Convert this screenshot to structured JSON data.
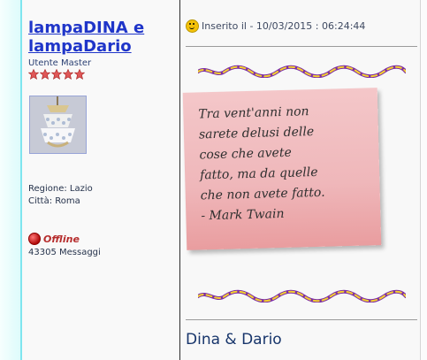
{
  "user": {
    "name": "lampaDINA e lampaDario",
    "rank": "Utente Master",
    "star_count": 5,
    "region": "Regione: Lazio",
    "city": "Città: Roma",
    "status": "Offline",
    "messages": "43305 Messaggi"
  },
  "post": {
    "date_text": "Inserito il - 10/03/2015 : 06:24:44",
    "quote_text": "Tra vent'anni non\nsarete delusi delle\ncose che avete\nfatto, ma da quelle\nche non avete fatto.\n- Mark Twain",
    "signature": "Dina & Dario"
  },
  "icons": {
    "smiley": "smiley-icon",
    "status": "status-dot-icon",
    "star": "star-icon"
  },
  "colors": {
    "link": "#1f35c9",
    "note": "#efb7ba",
    "offline": "#b62d2d",
    "accent_strip": "#7fe5ef"
  }
}
